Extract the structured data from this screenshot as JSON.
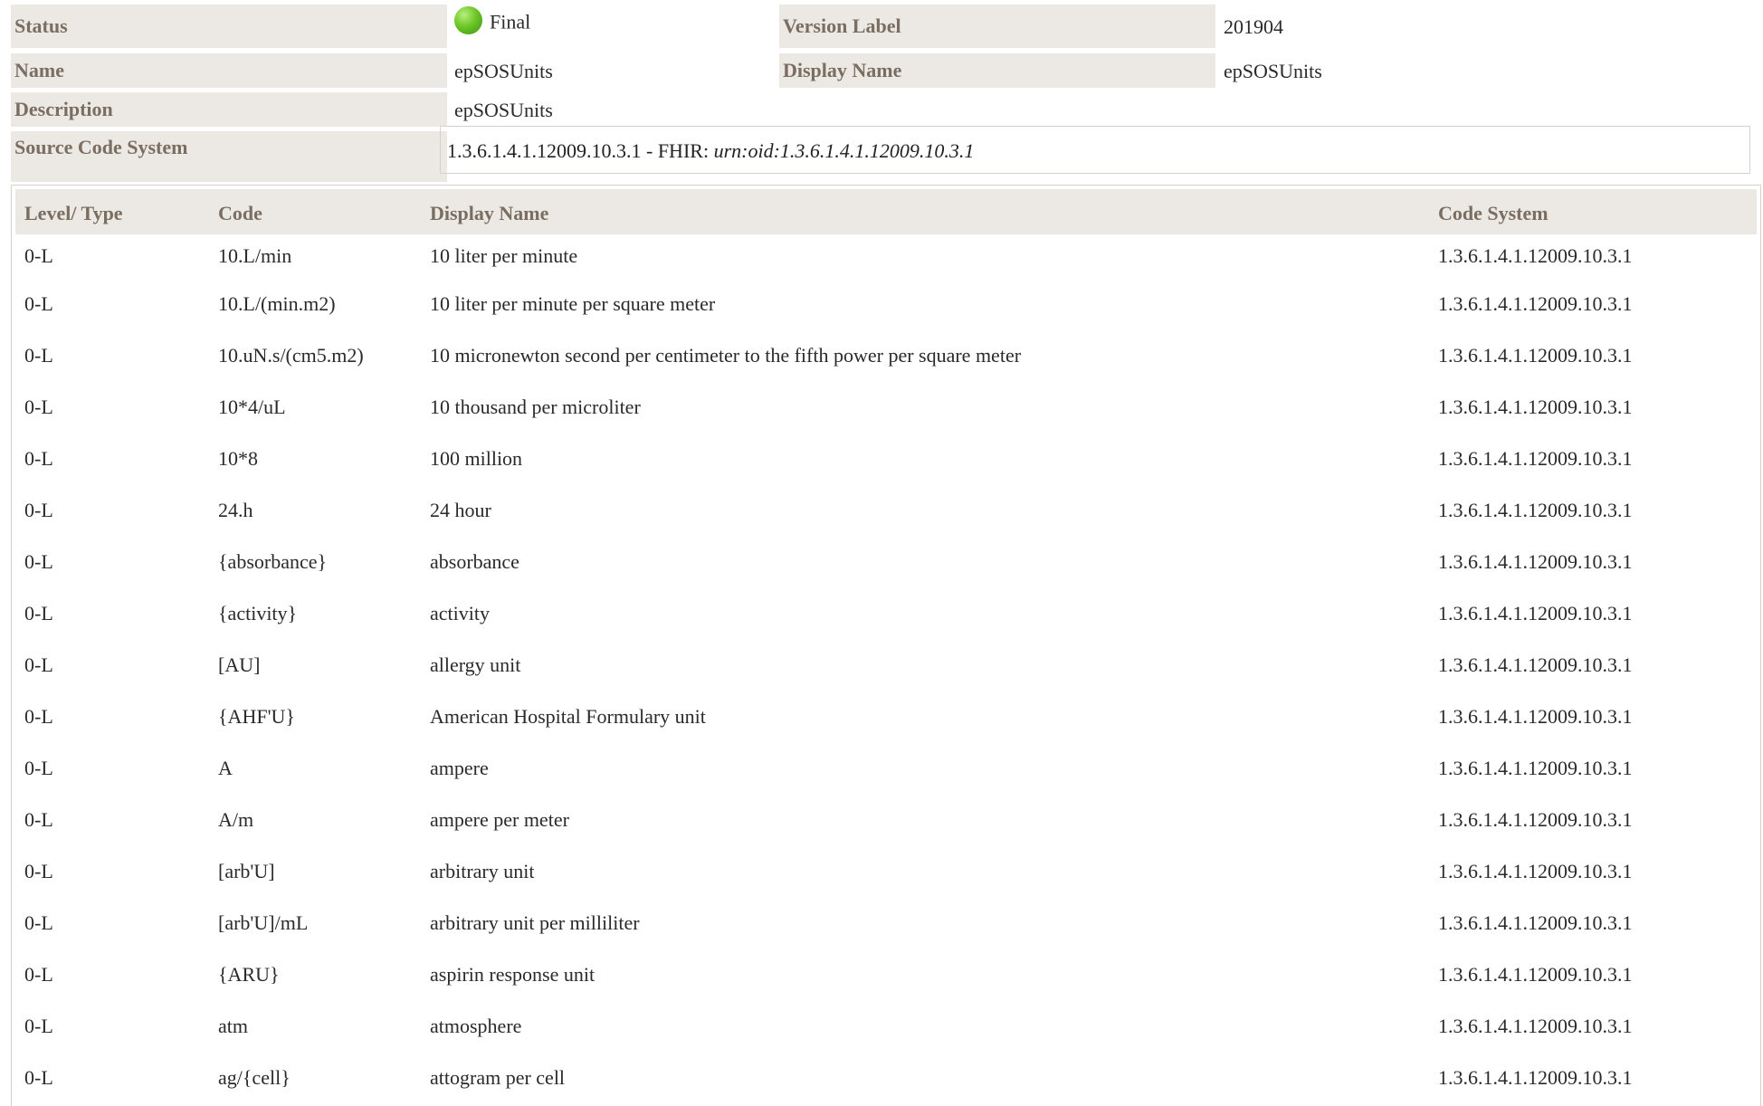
{
  "meta": {
    "status_label": "Status",
    "status_value": "Final",
    "status_icon": "green-status-circle",
    "version_label": "Version Label",
    "version_value": "201904",
    "name_label": "Name",
    "name_value": "epSOSUnits",
    "display_name_label": "Display Name",
    "display_name_value": "epSOSUnits",
    "description_label": "Description",
    "description_value": "epSOSUnits",
    "source_label": "Source Code System",
    "source_value": "1.3.6.1.4.1.12009.10.3.1 - FHIR: ",
    "source_fhir": "urn:oid:1.3.6.1.4.1.12009.10.3.1"
  },
  "table": {
    "headers": [
      "Level/ Type",
      "Code",
      "Display Name",
      "Code System"
    ],
    "rows": [
      [
        "0-L",
        "10.L/min",
        "10 liter per minute",
        "1.3.6.1.4.1.12009.10.3.1"
      ],
      [
        "0-L",
        "10.L/(min.m2)",
        "10 liter per minute per square meter",
        "1.3.6.1.4.1.12009.10.3.1"
      ],
      [
        "0-L",
        "10.uN.s/(cm5.m2)",
        "10 micronewton second per centimeter to the fifth power per square meter",
        "1.3.6.1.4.1.12009.10.3.1"
      ],
      [
        "0-L",
        "10*4/uL",
        "10 thousand per microliter",
        "1.3.6.1.4.1.12009.10.3.1"
      ],
      [
        "0-L",
        "10*8",
        "100 million",
        "1.3.6.1.4.1.12009.10.3.1"
      ],
      [
        "0-L",
        "24.h",
        "24 hour",
        "1.3.6.1.4.1.12009.10.3.1"
      ],
      [
        "0-L",
        "{absorbance}",
        "absorbance",
        "1.3.6.1.4.1.12009.10.3.1"
      ],
      [
        "0-L",
        "{activity}",
        "activity",
        "1.3.6.1.4.1.12009.10.3.1"
      ],
      [
        "0-L",
        "[AU]",
        "allergy unit",
        "1.3.6.1.4.1.12009.10.3.1"
      ],
      [
        "0-L",
        "{AHF'U}",
        "American Hospital Formulary unit",
        "1.3.6.1.4.1.12009.10.3.1"
      ],
      [
        "0-L",
        "A",
        "ampere",
        "1.3.6.1.4.1.12009.10.3.1"
      ],
      [
        "0-L",
        "A/m",
        "ampere per meter",
        "1.3.6.1.4.1.12009.10.3.1"
      ],
      [
        "0-L",
        "[arb'U]",
        "arbitrary unit",
        "1.3.6.1.4.1.12009.10.3.1"
      ],
      [
        "0-L",
        "[arb'U]/mL",
        "arbitrary unit per milliliter",
        "1.3.6.1.4.1.12009.10.3.1"
      ],
      [
        "0-L",
        "{ARU}",
        "aspirin response unit",
        "1.3.6.1.4.1.12009.10.3.1"
      ],
      [
        "0-L",
        "atm",
        "atmosphere",
        "1.3.6.1.4.1.12009.10.3.1"
      ],
      [
        "0-L",
        "ag/{cell}",
        "attogram per cell",
        "1.3.6.1.4.1.12009.10.3.1"
      ]
    ]
  }
}
